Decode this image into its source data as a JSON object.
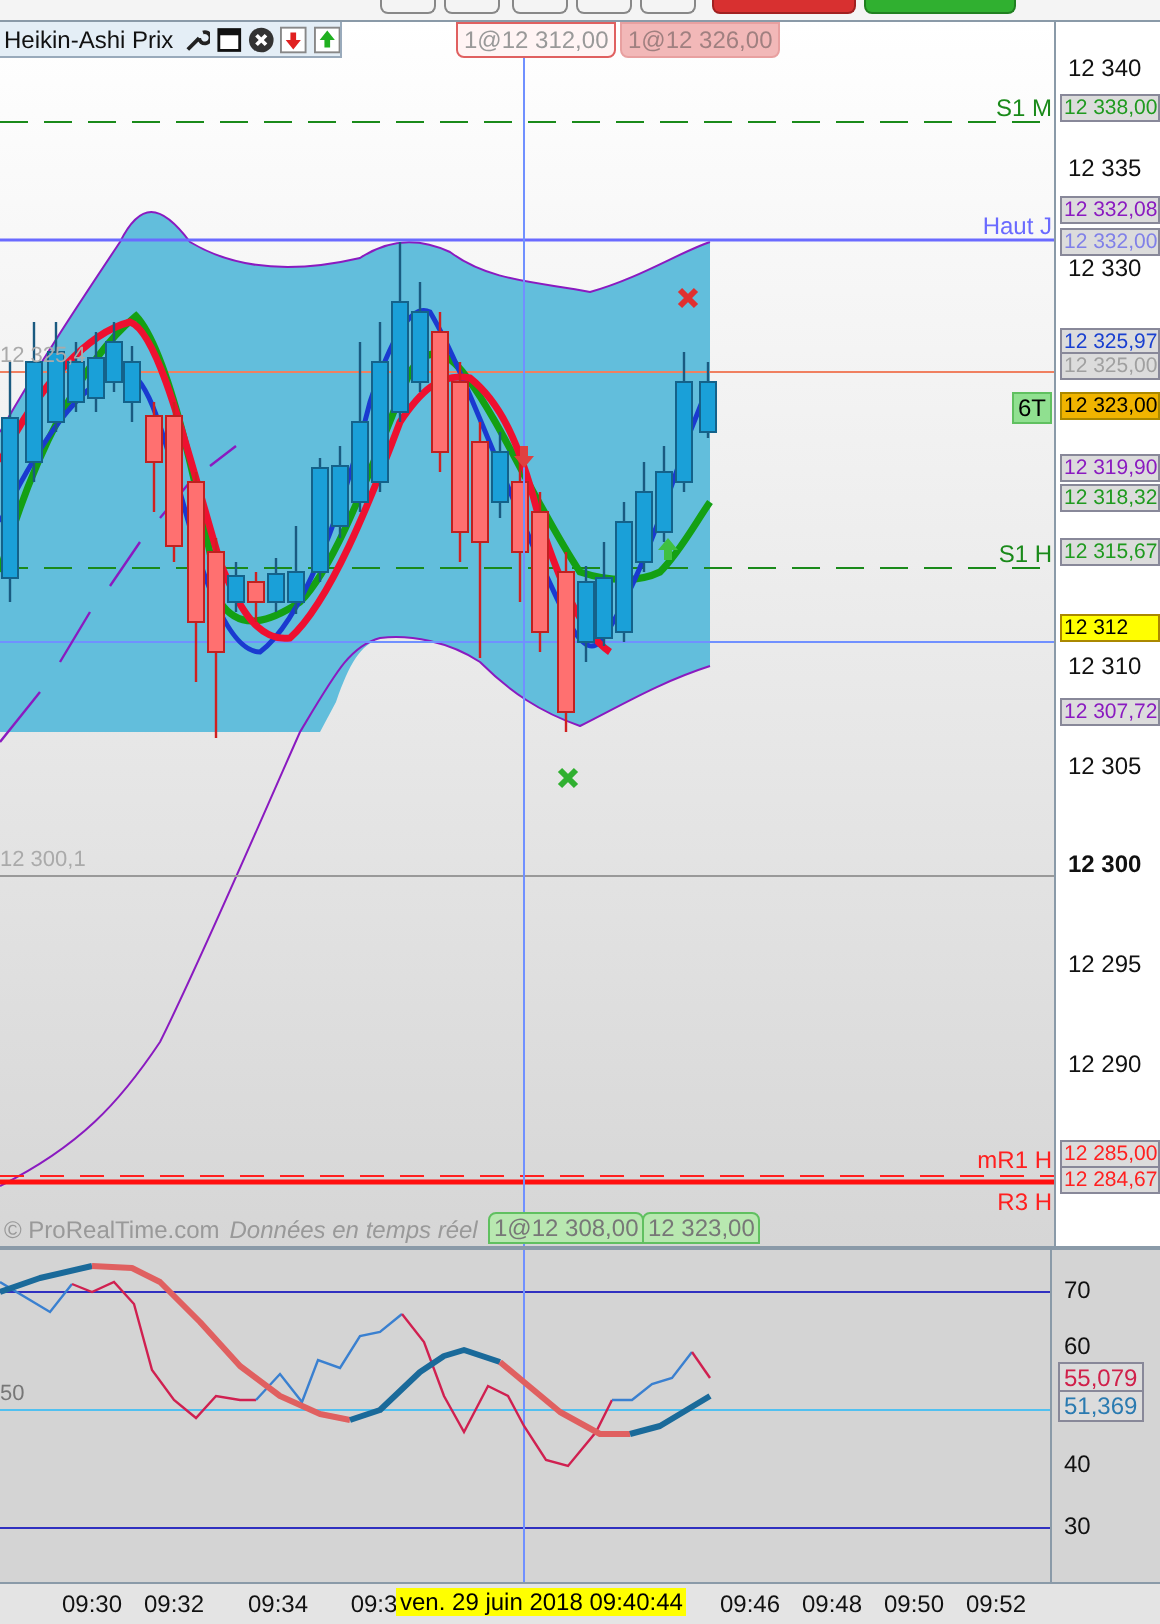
{
  "toolbar": {
    "title": "Heikin-Ashi Prix"
  },
  "order_tags_top": [
    {
      "text": "1@12 312,00",
      "kind": "outline"
    },
    {
      "text": "1@12 326,00",
      "kind": "filled"
    }
  ],
  "price_chart": {
    "line_labels": [
      {
        "text": "S1 M",
        "color": "#1a8a1a"
      },
      {
        "text": "Haut J",
        "color": "#6a6aff"
      },
      {
        "text": "S1 H",
        "color": "#1a8a1a"
      },
      {
        "text": "mR1 H",
        "color": "#ff2020"
      },
      {
        "text": "R3 H",
        "color": "#ff2020"
      }
    ],
    "left_labels": [
      "12 325,4",
      "12 300,1"
    ],
    "axis_ticks": [
      {
        "text": "12 340",
        "bold": false
      },
      {
        "text": "12 335",
        "bold": false
      },
      {
        "text": "12 330",
        "bold": false
      },
      {
        "text": "12 310",
        "bold": false
      },
      {
        "text": "12 305",
        "bold": false
      },
      {
        "text": "12 300",
        "bold": true
      },
      {
        "text": "12 295",
        "bold": false
      },
      {
        "text": "12 290",
        "bold": false
      }
    ],
    "price_tags": [
      {
        "text": "12 338,00",
        "kind": "box",
        "color": "#1f9a1f"
      },
      {
        "text": "12 332,08",
        "kind": "box",
        "color": "#8a1ac0"
      },
      {
        "text": "12 332,00",
        "kind": "box",
        "color": "#8080e8"
      },
      {
        "text": "12 325,97",
        "kind": "box",
        "color": "#1a40d0"
      },
      {
        "text": "12 325,00",
        "kind": "box",
        "color": "#a0a0a0"
      },
      {
        "text": "12 323,00",
        "kind": "highlight",
        "color": "#f0b400"
      },
      {
        "text": "12 319,90",
        "kind": "box",
        "color": "#8a1ac0"
      },
      {
        "text": "12 318,32",
        "kind": "box",
        "color": "#1f9a1f"
      },
      {
        "text": "12 315,67",
        "kind": "box",
        "color": "#1f9a1f"
      },
      {
        "text": "12 312",
        "kind": "highlight",
        "color": "#ffff00"
      },
      {
        "text": "12 307,72",
        "kind": "box",
        "color": "#8a1ac0"
      },
      {
        "text": "12 285,00",
        "kind": "box",
        "color": "#ff2020"
      },
      {
        "text": "12 284,67",
        "kind": "box",
        "color": "#ff2020"
      }
    ],
    "badge": "6T",
    "order_tags_bottom": [
      "1@12 308,00",
      "12 323,00"
    ],
    "copyright": "© ProRealTime.com",
    "realtime_note": "Données en temps réel"
  },
  "oscillator": {
    "left_label": "50",
    "axis_ticks": [
      "70",
      "60",
      "40",
      "30"
    ],
    "value_tags": [
      {
        "text": "55,079",
        "color": "#d0204a"
      },
      {
        "text": "51,369",
        "color": "#2a7ab0"
      }
    ]
  },
  "time_axis": {
    "ticks": [
      "09:30",
      "09:32",
      "09:34",
      "09:3",
      "09:46",
      "09:48",
      "09:50",
      "09:52"
    ],
    "cursor_label": "ven. 29 juin 2018 09:40:44"
  }
}
